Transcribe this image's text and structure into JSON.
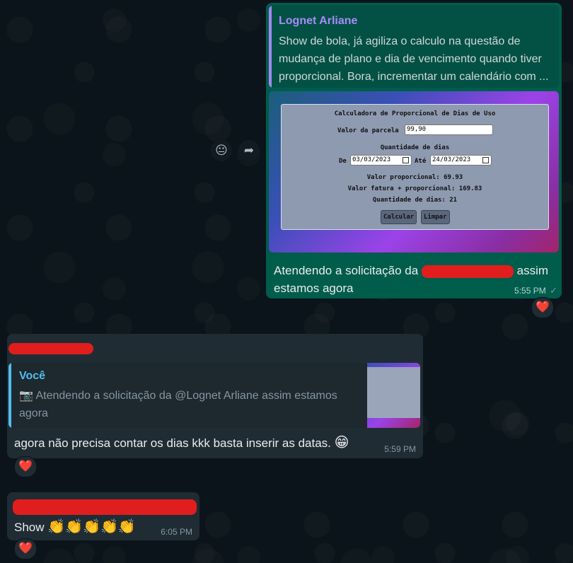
{
  "messages": {
    "outgoing": {
      "quote_author": "Lognet Arliane",
      "quote_text": "Show de bola, já agiliza o calculo na questão de mudança de plano e dia de vencimento quando tiver proporcional. Bora, incrementar um calendário com ...",
      "calculator": {
        "title": "Calculadora de Proporcional de Dias de Uso",
        "parcela_label": "Valor da parcela",
        "parcela_value": "99,90",
        "dias_heading": "Quantidade de dias",
        "de_label": "De",
        "de_value": "03/03/2023",
        "ate_label": "Até",
        "ate_value": "24/03/2023",
        "result_proporcional": "Valor proporcional: 69.93",
        "result_fatura": "Valor fatura + proporcional: 169.83",
        "result_dias": "Quantidade de dias: 21",
        "calcular_label": "Calcular",
        "limpar_label": "Limpar"
      },
      "text_before": "Atendendo a solicitação da",
      "text_after": "assim estamos agora",
      "time": "5:55 PM",
      "reaction": "❤️"
    },
    "incoming_1": {
      "quote_author": "Você",
      "quote_text": "Atendendo a solicitação da @Lognet Arliane assim estamos agora",
      "text": "agora não precisa contar os dias kkk basta inserir as datas.",
      "emoji": "😁",
      "time": "5:59 PM",
      "reaction": "❤️"
    },
    "incoming_2": {
      "text": "Show",
      "emoji": "👏👏👏👏👏",
      "time": "6:05 PM",
      "reaction": "❤️"
    }
  },
  "icons": {
    "emoji_button": "😐",
    "forward_button": "➦",
    "camera": "📷",
    "sent_tick": "✓"
  },
  "colors": {
    "outgoing_bubble": "#005c4b",
    "incoming_bubble": "#202c33",
    "redaction": "#e01e1e"
  }
}
